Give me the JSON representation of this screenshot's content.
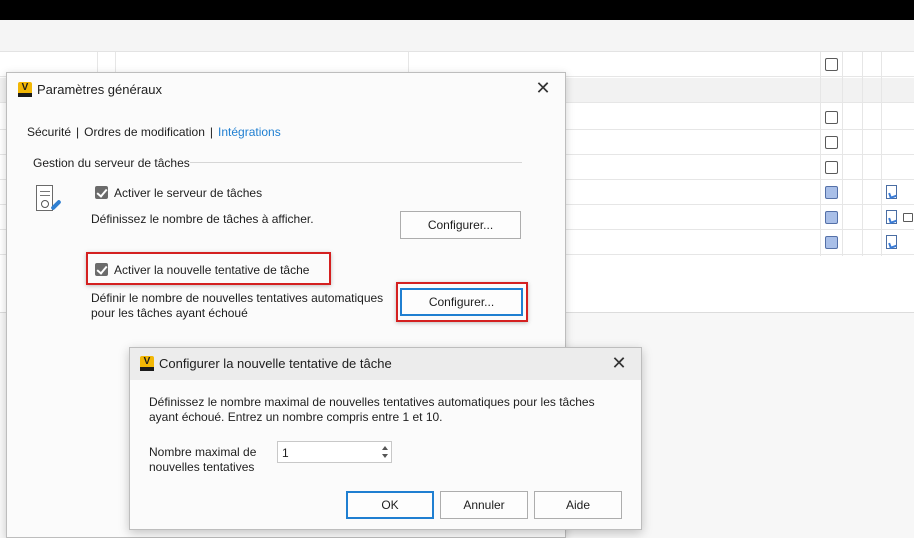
{
  "main_dialog": {
    "title": "Paramètres généraux",
    "tabs": [
      {
        "label": "Sécurité"
      },
      {
        "label": "Ordres de modification"
      },
      {
        "label": "Intégrations"
      }
    ],
    "tab_separator": "|",
    "group_title": "Gestion du serveur de tâches",
    "enable_server_label": "Activer le serveur de tâches",
    "enable_server_checked": true,
    "tasks_desc": "Définissez le nombre de tâches à afficher.",
    "configure_button_1": "Configurer...",
    "enable_retry_label": "Activer la nouvelle tentative de tâche",
    "enable_retry_checked": true,
    "retry_desc_line1": "Définir le nombre de nouvelles tentatives automatiques",
    "retry_desc_line2": "pour les tâches ayant échoué",
    "configure_button_2": "Configurer...",
    "close_glyph": "✕"
  },
  "retry_dialog": {
    "title": "Configurer la nouvelle tentative de tâche",
    "desc_line1": "Définissez le nombre maximal de nouvelles tentatives automatiques pour les tâches",
    "desc_line2": "ayant échoué. Entrez un nombre compris entre 1 et 10.",
    "field_label_line1": "Nombre maximal de",
    "field_label_line2": "nouvelles tentatives",
    "field_value": "1",
    "ok_button": "OK",
    "cancel_button": "Annuler",
    "help_button": "Aide",
    "close_glyph": "✕"
  },
  "app_logo_letter": "V",
  "colors": {
    "accent": "#1f7fd1",
    "highlight_box": "#d42020",
    "logo": "#f2b705"
  },
  "background_rows": [
    {
      "checkbox": "empty",
      "icons": []
    },
    {
      "checkbox": "none",
      "icons": []
    },
    {
      "checkbox": "empty",
      "icons": []
    },
    {
      "checkbox": "empty",
      "icons": []
    },
    {
      "checkbox": "empty",
      "icons": []
    },
    {
      "checkbox": "filled",
      "icons": [
        "document-icon"
      ]
    },
    {
      "checkbox": "filled",
      "icons": [
        "document-icon",
        "folder-icon"
      ]
    },
    {
      "checkbox": "filled",
      "icons": [
        "document-icon"
      ]
    }
  ]
}
